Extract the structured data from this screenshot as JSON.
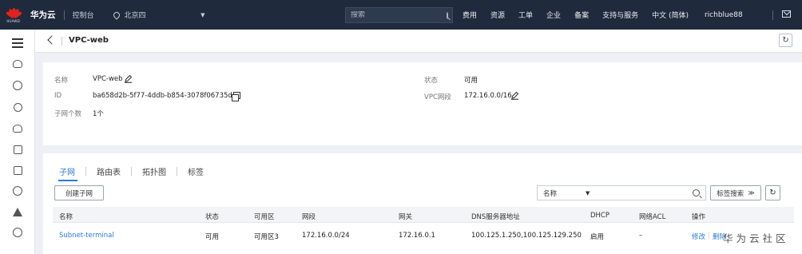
{
  "topbar": {
    "logo_text": "HUAWEI",
    "brand": "华为云",
    "console": "控制台",
    "region": "北京四",
    "search_placeholder": "搜索",
    "links": [
      "费用",
      "资源",
      "工单",
      "企业",
      "备案",
      "支持与服务"
    ],
    "language": "中文 (简体)",
    "user": "richblue88"
  },
  "header": {
    "title": "VPC-web"
  },
  "info": {
    "name_label": "名称",
    "name_value": "VPC-web",
    "id_label": "ID",
    "id_value": "ba658d2b-5f77-4ddb-b854-3078f06735d1",
    "subnet_count_label": "子网个数",
    "subnet_count_value": "1个",
    "status_label": "状态",
    "status_value": "可用",
    "cidr_label": "VPC网段",
    "cidr_value": "172.16.0.0/16"
  },
  "tabs": [
    "子网",
    "路由表",
    "拓扑图",
    "标签"
  ],
  "toolbar": {
    "create_subnet": "创建子网",
    "filter_field": "名称",
    "tag_search": "标签搜索"
  },
  "table": {
    "columns": [
      "名称",
      "状态",
      "可用区",
      "网段",
      "网关",
      "DNS服务器地址",
      "DHCP",
      "网络ACL",
      "操作"
    ],
    "rows": [
      {
        "name": "Subnet-terminal",
        "status": "可用",
        "az": "可用区3",
        "cidr": "172.16.0.0/24",
        "gateway": "172.16.0.1",
        "dns": "100.125.1.250,100.125.129.250",
        "dhcp": "启用",
        "acl": "–",
        "actions": [
          "修改",
          "删除"
        ]
      }
    ]
  },
  "watermark": "华为云社区"
}
